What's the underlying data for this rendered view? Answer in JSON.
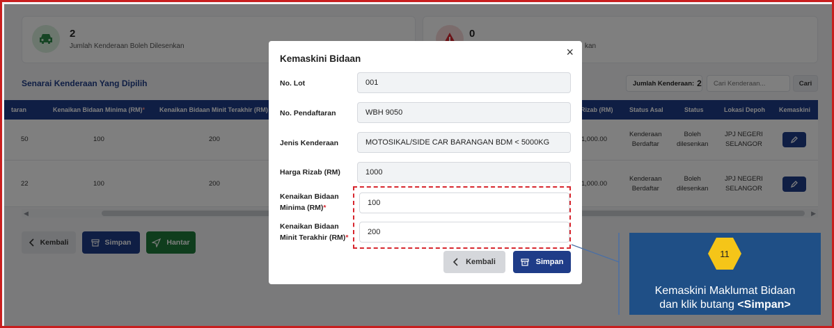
{
  "summary": {
    "allowed": {
      "count": "2",
      "label": "Jumlah Kenderaan Boleh Dilesenkan"
    },
    "blocked": {
      "count": "0",
      "label_partial": "kan"
    }
  },
  "list": {
    "title": "Senarai Kenderaan Yang Dipilih",
    "count_label": "Jumlah Kenderaan:",
    "count_value": "2",
    "search_placeholder": "Cari Kenderaan...",
    "search_button": "Cari"
  },
  "table": {
    "headers": {
      "daftaran": "taran",
      "min_bid": "Kenaikan Bidaan Minima (RM)",
      "req_mark": "*",
      "last_min_bid": "Kenaikan Bidaan Minit Terakhir (RM)",
      "reserve": "Rizab (RM)",
      "status_asal": "Status Asal",
      "status": "Status",
      "depoh": "Lokasi Depoh",
      "edit": "Kemaskini"
    },
    "rows": [
      {
        "col0": "50",
        "min_bid": "100",
        "last_min_bid": "200",
        "reserve": "1,000.00",
        "status_asal_1": "Kenderaan",
        "status_asal_2": "Berdaftar",
        "status_1": "Boleh",
        "status_2": "dilesenkan",
        "depoh_1": "JPJ NEGERI",
        "depoh_2": "SELANGOR"
      },
      {
        "col0": "22",
        "min_bid": "100",
        "last_min_bid": "200",
        "reserve": "1,000.00",
        "status_asal_1": "Kenderaan",
        "status_asal_2": "Berdaftar",
        "status_1": "Boleh",
        "status_2": "dilesenkan",
        "depoh_1": "JPJ NEGERI",
        "depoh_2": "SELANGOR"
      }
    ]
  },
  "actions": {
    "back": "Kembali",
    "save": "Simpan",
    "submit": "Hantar"
  },
  "modal": {
    "title": "Kemaskini Bidaan",
    "close": "×",
    "lot_label": "No. Lot",
    "lot_value": "001",
    "reg_label": "No. Pendaftaran",
    "reg_value": "WBH 9050",
    "type_label": "Jenis Kenderaan",
    "type_value": "MOTOSIKAL/SIDE CAR BARANGAN BDM < 5000KG",
    "reserve_label": "Harga Rizab (RM)",
    "reserve_value": "1000",
    "min_label_1": "Kenaikan Bidaan",
    "min_label_2": "Minima (RM)",
    "min_value": "100",
    "last_label_1": "Kenaikan Bidaan",
    "last_label_2": "Minit Terakhir (RM)",
    "last_value": "200",
    "req": "*",
    "back": "Kembali",
    "save": "Simpan"
  },
  "callout": {
    "step": "11",
    "line1": "Kemaskini Maklumat Bidaan",
    "line2_prefix": "dan klik butang",
    "line2_bold": "<Simpan>"
  },
  "colors": {
    "primary": "#1f3c88",
    "highlight": "#d7262e",
    "callout_bg": "#1f4f86",
    "step_badge": "#f5c518",
    "submit_green": "#1e7a3a"
  }
}
